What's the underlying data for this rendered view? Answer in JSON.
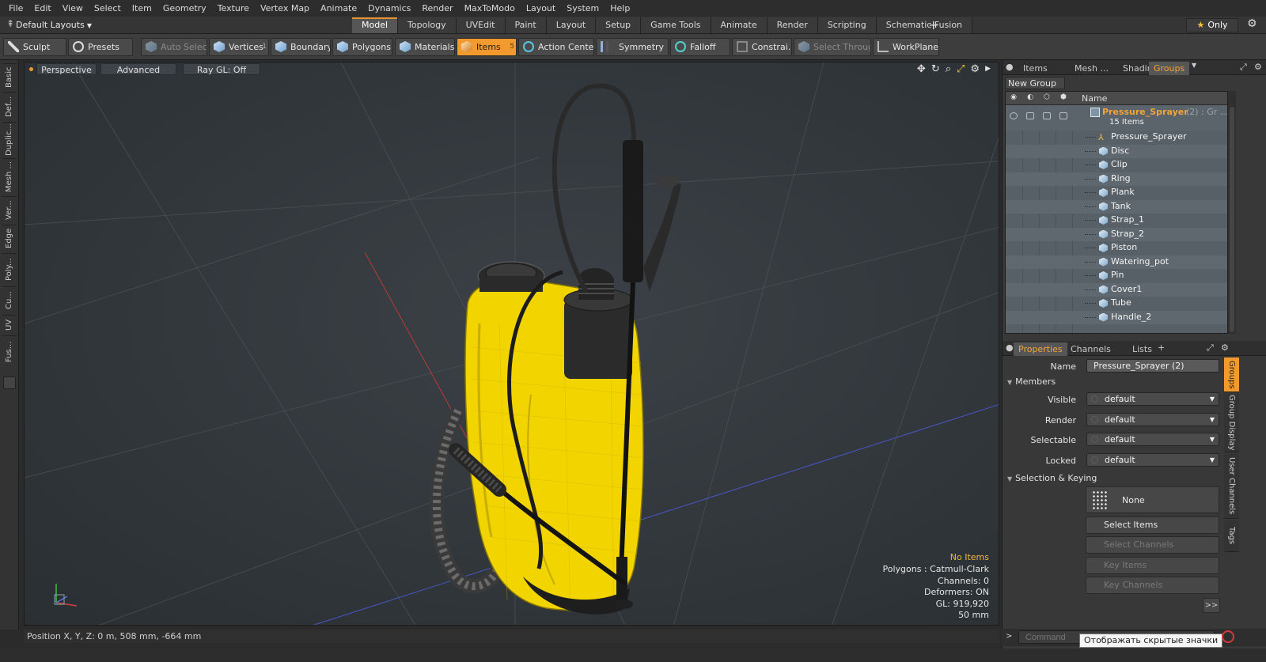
{
  "menu": [
    "File",
    "Edit",
    "View",
    "Select",
    "Item",
    "Geometry",
    "Texture",
    "Vertex Map",
    "Animate",
    "Dynamics",
    "Render",
    "MaxToModo",
    "Layout",
    "System",
    "Help"
  ],
  "layout_selector": "Default Layouts",
  "tabs": [
    "Model",
    "Topology",
    "UVEdit",
    "Paint",
    "Layout",
    "Setup",
    "Game Tools",
    "Animate",
    "Render",
    "Scripting",
    "Schematic Fusion"
  ],
  "active_tab": "Model",
  "only_label": "Only",
  "toolbar": {
    "sculpt": "Sculpt",
    "presets": "Presets",
    "auto_select": "Auto Select",
    "vertices": "Vertices",
    "vertices_count": "1",
    "boundary": "Boundary",
    "polygons": "Polygons",
    "materials": "Materials",
    "items": "Items",
    "items_count": "5",
    "action_center": "Action Center",
    "symmetry": "Symmetry",
    "falloff": "Falloff",
    "constraints": "Constrai...",
    "select_through": "Select Through",
    "workplane": "WorkPlane"
  },
  "left_tabs": [
    "Basic",
    "Def...",
    "Duplic...",
    "Mesh ...",
    "Ver...",
    "Edge",
    "Poly...",
    "Cu...",
    "UV",
    "Fus..."
  ],
  "viewport": {
    "view_mode": "Perspective",
    "advanced": "Advanced",
    "raygl": "Ray GL: Off",
    "hud": {
      "selection": "No Items",
      "polygons": "Polygons : Catmull-Clark",
      "channels": "Channels: 0",
      "deformers": "Deformers: ON",
      "gl": "GL: 919,920",
      "scale": "50 mm"
    }
  },
  "status_bar": "Position X, Y, Z:  0 m, 508 mm, -664 mm",
  "panel_tabs": [
    "Items",
    "Mesh ...",
    "Shading",
    "Groups"
  ],
  "active_panel_tab": "Groups",
  "groups": {
    "new_group": "New Group",
    "name_header": "Name",
    "group_name": "Pressure_Sprayer",
    "group_extra": "(2) : Gr ...",
    "group_count": "15 Items",
    "items": [
      "Pressure_Sprayer",
      "Disc",
      "Clip",
      "Ring",
      "Plank",
      "Tank",
      "Strap_1",
      "Strap_2",
      "Piston",
      "Watering_pot",
      "Pin",
      "Cover1",
      "Tube",
      "Handle_2"
    ]
  },
  "prop_tabs": [
    "Properties",
    "Channels",
    "Lists"
  ],
  "active_prop_tab": "Properties",
  "properties": {
    "name_label": "Name",
    "name_value": "Pressure_Sprayer (2)",
    "members_section": "Members",
    "visible_label": "Visible",
    "visible_value": "default",
    "render_label": "Render",
    "render_value": "default",
    "selectable_label": "Selectable",
    "selectable_value": "default",
    "locked_label": "Locked",
    "locked_value": "default",
    "sel_section": "Selection & Keying",
    "none_btn": "None",
    "select_items": "Select Items",
    "select_channels": "Select Channels",
    "key_items": "Key Items",
    "key_channels": "Key Channels",
    "more": ">>"
  },
  "right_vtabs": [
    "Groups",
    "Group Display",
    "User Channels",
    "Tags"
  ],
  "command_placeholder": "Command",
  "tooltip": "Отображать скрытые значки",
  "colors": {
    "accent": "#f29a2e",
    "highlight": "#f2a33a",
    "tank_yellow": "#f5d800"
  }
}
